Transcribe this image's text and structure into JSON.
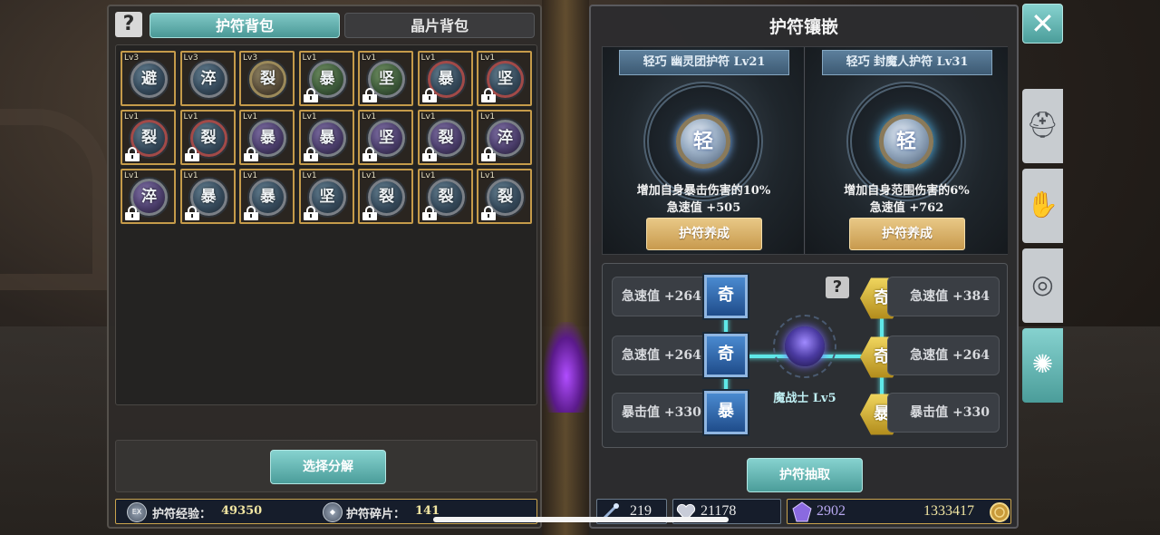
{
  "left_panel": {
    "tabs": [
      "护符背包",
      "晶片背包"
    ],
    "charms": [
      {
        "lv": "Lv3",
        "glyph": "避",
        "locked": false,
        "tone": "blue"
      },
      {
        "lv": "Lv3",
        "glyph": "淬",
        "locked": false,
        "tone": "blue"
      },
      {
        "lv": "Lv3",
        "glyph": "裂",
        "locked": false,
        "tone": "gold"
      },
      {
        "lv": "Lv1",
        "glyph": "暴",
        "locked": true,
        "tone": "green"
      },
      {
        "lv": "Lv1",
        "glyph": "坚",
        "locked": true,
        "tone": "green"
      },
      {
        "lv": "Lv1",
        "glyph": "暴",
        "locked": true,
        "tone": "red"
      },
      {
        "lv": "Lv1",
        "glyph": "坚",
        "locked": true,
        "tone": "red"
      },
      {
        "lv": "Lv1",
        "glyph": "裂",
        "locked": true,
        "tone": "red"
      },
      {
        "lv": "Lv1",
        "glyph": "裂",
        "locked": true,
        "tone": "red"
      },
      {
        "lv": "Lv1",
        "glyph": "暴",
        "locked": true,
        "tone": "purple"
      },
      {
        "lv": "Lv1",
        "glyph": "暴",
        "locked": true,
        "tone": "purple"
      },
      {
        "lv": "Lv1",
        "glyph": "坚",
        "locked": true,
        "tone": "purple"
      },
      {
        "lv": "Lv1",
        "glyph": "裂",
        "locked": true,
        "tone": "purple"
      },
      {
        "lv": "Lv1",
        "glyph": "淬",
        "locked": true,
        "tone": "purple"
      },
      {
        "lv": "Lv1",
        "glyph": "淬",
        "locked": true,
        "tone": "purple"
      },
      {
        "lv": "Lv1",
        "glyph": "暴",
        "locked": true,
        "tone": "blue"
      },
      {
        "lv": "Lv1",
        "glyph": "暴",
        "locked": true,
        "tone": "blue"
      },
      {
        "lv": "Lv1",
        "glyph": "坚",
        "locked": true,
        "tone": "blue"
      },
      {
        "lv": "Lv1",
        "glyph": "裂",
        "locked": true,
        "tone": "blue"
      },
      {
        "lv": "Lv1",
        "glyph": "裂",
        "locked": true,
        "tone": "blue"
      },
      {
        "lv": "Lv1",
        "glyph": "裂",
        "locked": true,
        "tone": "blue"
      }
    ],
    "decompose_label": "选择分解",
    "exp_label": "护符经验：",
    "exp_value": "49350",
    "shard_label": "护符碎片：",
    "shard_value": "141",
    "exp_icon_text": "EX"
  },
  "right_panel": {
    "title": "护符镶嵌",
    "amulets": [
      {
        "name": "轻巧 幽灵团护符 Lv21",
        "glyph": "轻",
        "desc": "增加自身暴击伤害的10%",
        "speed": "急速值 +505",
        "button": "护符养成"
      },
      {
        "name": "轻巧 封魔人护符 Lv31",
        "glyph": "轻",
        "desc": "增加自身范围伤害的6%",
        "speed": "急速值 +762",
        "button": "护符养成"
      }
    ],
    "left_sockets": [
      {
        "stat": "急速值 +264",
        "glyph": "奇"
      },
      {
        "stat": "急速值 +264",
        "glyph": "奇"
      },
      {
        "stat": "暴击值 +330",
        "glyph": "暴"
      }
    ],
    "right_sockets": [
      {
        "stat": "急速值 +384",
        "glyph": "奇"
      },
      {
        "stat": "急速值 +264",
        "glyph": "奇"
      },
      {
        "stat": "暴击值 +330",
        "glyph": "暴"
      }
    ],
    "hero_label": "魔战士 Lv5",
    "extract_label": "护符抽取",
    "currencies": {
      "a": "219",
      "b": "21178",
      "c": "2902",
      "d": "1333417"
    }
  },
  "side": {
    "close_glyph": "✕",
    "tabs": [
      {
        "icon": "helmet-icon",
        "glyph": "⛑"
      },
      {
        "icon": "gloves-icon",
        "glyph": "✋"
      },
      {
        "icon": "ring-icon",
        "glyph": "◎"
      },
      {
        "icon": "amulet-icon",
        "glyph": "✺"
      }
    ]
  },
  "colors": {
    "accent_teal": "#4b9d9a",
    "gold_button": "#c89a4e",
    "link_cyan": "#5fe8e8"
  }
}
